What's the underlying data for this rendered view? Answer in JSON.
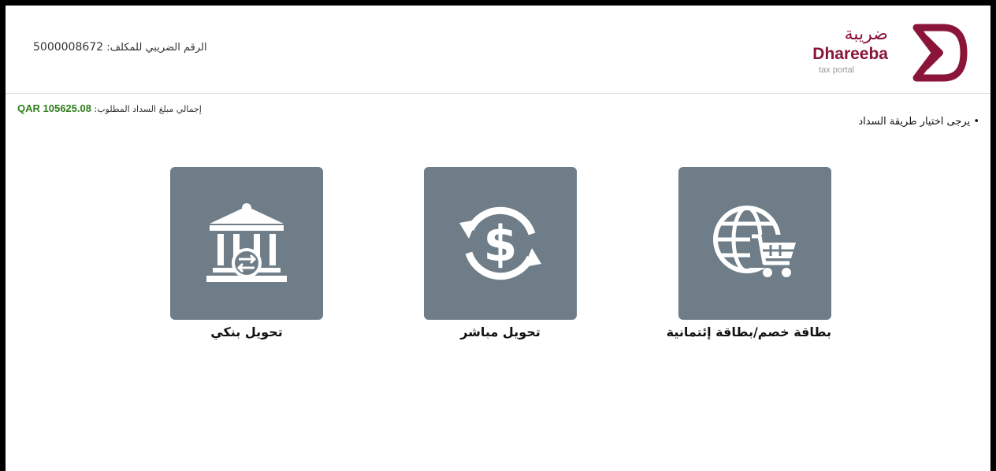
{
  "header": {
    "tax_number_label": "الرقم الضريبي للمكلف:",
    "tax_number_value": "5000008672",
    "logo": {
      "arabic_text": "ضريبة",
      "english_text": "Dhareeba",
      "subtitle": "tax portal"
    }
  },
  "payment": {
    "total_label": "إجمالي مبلغ السداد المطلوب:",
    "total_amount": "QAR 105625.08",
    "instruction": "• يرجى اختيار طريقة السداد",
    "methods": [
      {
        "label": "تحويل بنكي",
        "icon": "bank-transfer-icon"
      },
      {
        "label": "تحويل مباشر",
        "icon": "dollar-exchange-icon"
      },
      {
        "label": "بطاقة خصم/بطاقة إئتمانية",
        "icon": "globe-cart-icon"
      }
    ]
  },
  "colors": {
    "brand": "#8a1538",
    "tile": "#6e7d87",
    "amount": "#2e7d1a"
  }
}
